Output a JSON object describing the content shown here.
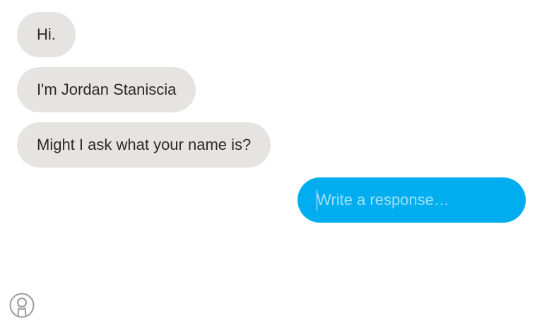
{
  "messages": [
    {
      "text": "Hi."
    },
    {
      "text": "I'm Jordan Staniscia"
    },
    {
      "text": "Might I ask what your name is?"
    }
  ],
  "response": {
    "value": "",
    "placeholder": "Write a response…"
  },
  "icons": {
    "profile": "user-circle-icon"
  },
  "colors": {
    "incoming_bubble": "#e5e4e2",
    "incoming_text": "#2b2b2b",
    "response_bubble": "#00aeef",
    "icon": "#9a9a9a"
  }
}
